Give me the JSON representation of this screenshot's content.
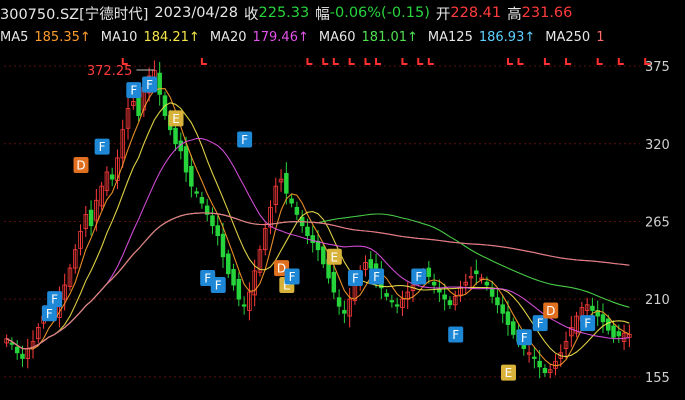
{
  "header": {
    "symbol": "300750.SZ[宁德时代]",
    "date": "2023/04/28",
    "close_label": "收",
    "close_value": "225.33",
    "change_label": "幅",
    "change_value": "-0.06%(-0.15)",
    "open_label": "开",
    "open_value": "228.41",
    "high_label": "高",
    "high_value": "231.66"
  },
  "ma": [
    {
      "label": "MA5",
      "value": "185.35↑",
      "color": "#ff9c2b"
    },
    {
      "label": "MA10",
      "value": "184.21↑",
      "color": "#f5e64a"
    },
    {
      "label": "MA20",
      "value": "179.46↑",
      "color": "#e352e8"
    },
    {
      "label": "MA60",
      "value": "181.01↑",
      "color": "#4fe04f"
    },
    {
      "label": "MA125",
      "value": "186.93↑",
      "color": "#5ed0ff"
    },
    {
      "label": "MA250",
      "value": "1",
      "color": "#ff6a6a"
    }
  ],
  "colors": {
    "up": "#ff3b3b",
    "down": "#27d43c",
    "grid": "#5a0f0f",
    "axis_text": "#d0d0d0"
  },
  "chart_data": {
    "type": "line",
    "ylim": [
      140,
      385
    ],
    "yticks": [
      375,
      320,
      265,
      210,
      155
    ],
    "peak_label": "372.25",
    "peak_value": 372.25,
    "close": [
      182,
      178,
      172,
      168,
      175,
      180,
      190,
      198,
      205,
      200,
      212,
      220,
      232,
      245,
      258,
      270,
      262,
      280,
      290,
      300,
      295,
      310,
      330,
      345,
      350,
      340,
      360,
      368,
      372,
      355,
      340,
      330,
      320,
      315,
      300,
      290,
      285,
      278,
      270,
      262,
      255,
      240,
      228,
      220,
      210,
      205,
      215,
      230,
      245,
      260,
      275,
      290,
      295,
      285,
      278,
      270,
      262,
      255,
      250,
      245,
      235,
      225,
      215,
      205,
      200,
      210,
      220,
      230,
      236,
      232,
      225,
      218,
      212,
      208,
      205,
      210,
      215,
      220,
      224,
      228,
      226,
      220,
      215,
      210,
      206,
      212,
      218,
      222,
      226,
      228,
      225,
      220,
      212,
      206,
      200,
      192,
      185,
      180,
      175,
      172,
      168,
      162,
      158,
      160,
      166,
      172,
      180,
      190,
      198,
      204,
      206,
      202,
      198,
      194,
      188,
      183,
      184,
      186,
      185
    ],
    "series": [
      {
        "name": "MA5",
        "values": []
      },
      {
        "name": "MA10",
        "values": []
      },
      {
        "name": "MA20",
        "values": []
      },
      {
        "name": "MA60",
        "values": []
      },
      {
        "name": "MA125",
        "values": []
      },
      {
        "name": "MA250",
        "values": []
      }
    ],
    "markers": [
      {
        "label": "F",
        "i": 8,
        "v": 200,
        "color": "#1e87d6"
      },
      {
        "label": "F",
        "i": 9,
        "v": 210,
        "color": "#1e87d6"
      },
      {
        "label": "D",
        "i": 14,
        "v": 305,
        "color": "#e0701f"
      },
      {
        "label": "F",
        "i": 18,
        "v": 318,
        "color": "#1e87d6"
      },
      {
        "label": "F",
        "i": 24,
        "v": 358,
        "color": "#1e87d6"
      },
      {
        "label": "F",
        "i": 27,
        "v": 362,
        "color": "#1e87d6"
      },
      {
        "label": "E",
        "i": 32,
        "v": 338,
        "color": "#d8b23a"
      },
      {
        "label": "F",
        "i": 45,
        "v": 323,
        "color": "#1e87d6"
      },
      {
        "label": "F",
        "i": 38,
        "v": 225,
        "color": "#1e87d6"
      },
      {
        "label": "F",
        "i": 40,
        "v": 220,
        "color": "#1e87d6"
      },
      {
        "label": "D",
        "i": 52,
        "v": 232,
        "color": "#e0701f"
      },
      {
        "label": "E",
        "i": 53,
        "v": 220,
        "color": "#d8b23a"
      },
      {
        "label": "F",
        "i": 54,
        "v": 226,
        "color": "#1e87d6"
      },
      {
        "label": "E",
        "i": 62,
        "v": 240,
        "color": "#d8b23a"
      },
      {
        "label": "F",
        "i": 66,
        "v": 225,
        "color": "#1e87d6"
      },
      {
        "label": "F",
        "i": 70,
        "v": 226,
        "color": "#1e87d6"
      },
      {
        "label": "F",
        "i": 78,
        "v": 226,
        "color": "#1e87d6"
      },
      {
        "label": "F",
        "i": 85,
        "v": 185,
        "color": "#1e87d6"
      },
      {
        "label": "E",
        "i": 95,
        "v": 158,
        "color": "#d8b23a"
      },
      {
        "label": "F",
        "i": 98,
        "v": 183,
        "color": "#1e87d6"
      },
      {
        "label": "F",
        "i": 101,
        "v": 193,
        "color": "#1e87d6"
      },
      {
        "label": "D",
        "i": 103,
        "v": 202,
        "color": "#e0701f"
      },
      {
        "label": "F",
        "i": 110,
        "v": 193,
        "color": "#1e87d6"
      }
    ]
  }
}
